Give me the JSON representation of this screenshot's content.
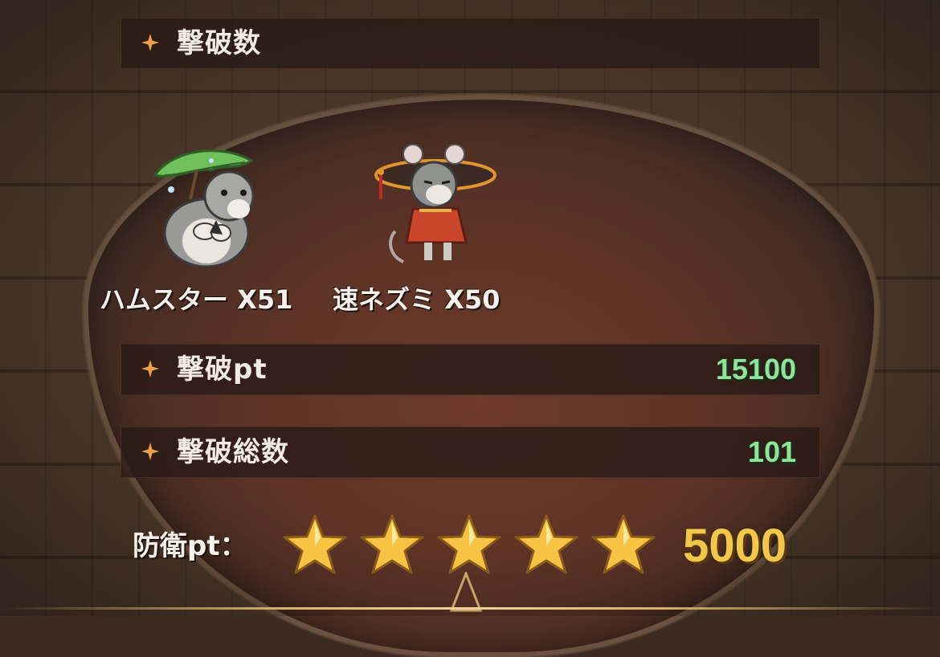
{
  "sections": {
    "kills": {
      "label": "撃破数"
    },
    "kill_pt": {
      "label": "撃破pt",
      "value": "15100"
    },
    "total_kills": {
      "label": "撃破総数",
      "value": "101"
    }
  },
  "monsters": [
    {
      "name": "ハムスター X51",
      "icon": "hamster-with-leaf-icon"
    },
    {
      "name": "速ネズミ X50",
      "icon": "speed-rat-with-hat-icon"
    }
  ],
  "defense": {
    "label": "防衛pt：",
    "stars": 5,
    "value": "5000"
  },
  "colors": {
    "value_green": "#8ee59a",
    "gold": "#f2c84a",
    "star_fill": "#f6c343",
    "spark": "#f0a04a"
  }
}
